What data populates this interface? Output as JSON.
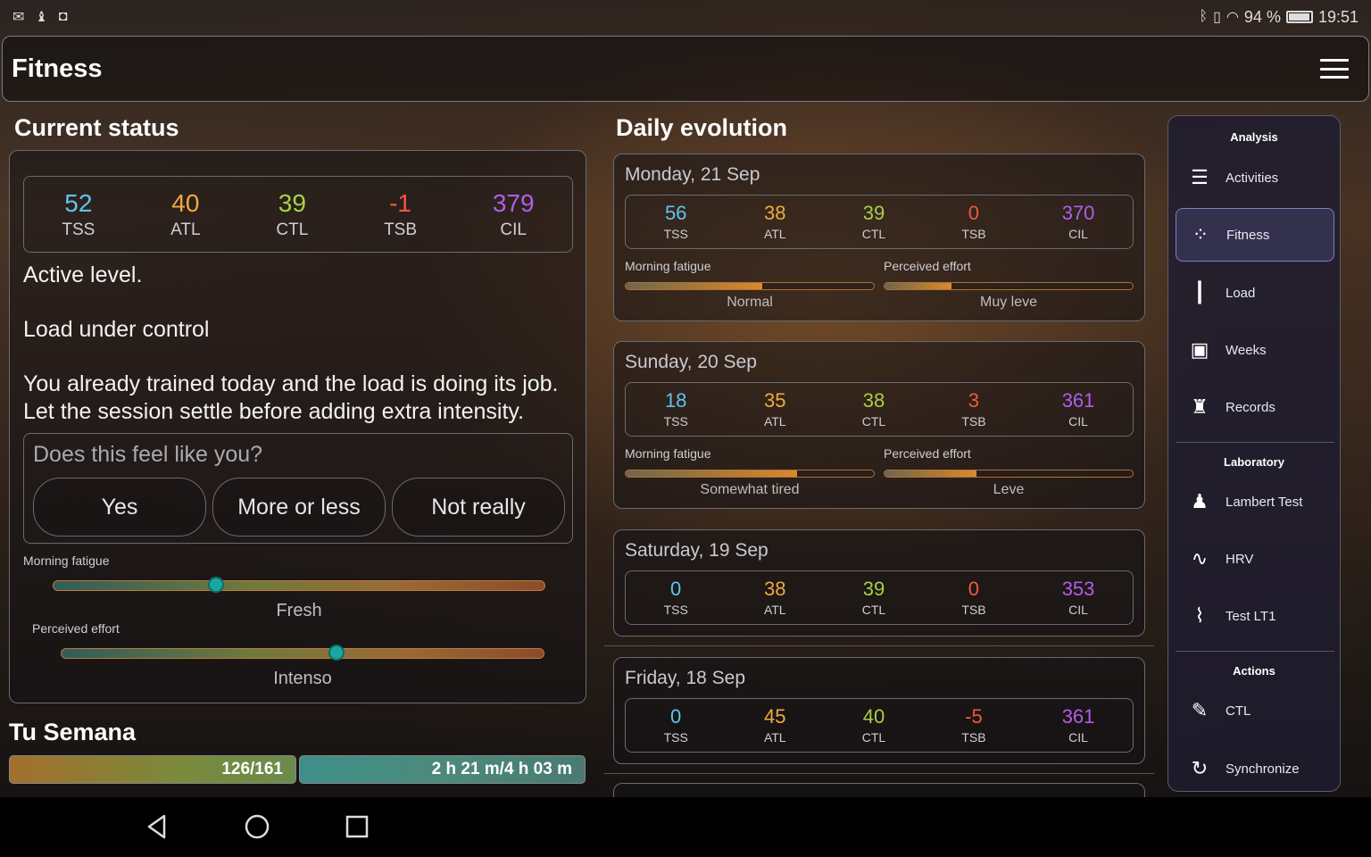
{
  "status_bar": {
    "time": "19:51",
    "battery": "94 %"
  },
  "app": {
    "title": "Fitness"
  },
  "current_status": {
    "title": "Current status",
    "metrics": [
      {
        "value": "52",
        "label": "TSS"
      },
      {
        "value": "40",
        "label": "ATL"
      },
      {
        "value": "39",
        "label": "CTL"
      },
      {
        "value": "-1",
        "label": "TSB"
      },
      {
        "value": "379",
        "label": "CIL"
      }
    ],
    "level": "Active level.",
    "load_status": "Load under control",
    "message_line1": "You already trained today and the load is doing its job.",
    "message_line2": "Let the session settle before adding extra intensity.",
    "question": "Does this feel like you?",
    "answers": [
      "Yes",
      "More or less",
      "Not really"
    ],
    "morning_fatigue_label": "Morning fatigue",
    "morning_fatigue_value": "Fresh",
    "morning_fatigue_level": 0.33,
    "perceived_effort_label": "Perceived effort",
    "perceived_effort_value": "Intenso",
    "perceived_effort_level": 0.57
  },
  "week": {
    "title": "Tu Semana",
    "load": "126/161",
    "time": "2 h 21 m/4 h 03 m"
  },
  "daily": {
    "title": "Daily evolution",
    "days": [
      {
        "date": "Monday, 21 Sep",
        "metrics": [
          "56",
          "38",
          "39",
          "0",
          "370"
        ],
        "fatigue_label": "Morning fatigue",
        "fatigue": "Normal",
        "fatigue_level": 0.55,
        "effort_label": "Perceived effort",
        "effort": "Muy leve",
        "effort_level": 0.27
      },
      {
        "date": "Sunday, 20 Sep",
        "metrics": [
          "18",
          "35",
          "38",
          "3",
          "361"
        ],
        "fatigue_label": "Morning fatigue",
        "fatigue": "Somewhat tired",
        "fatigue_level": 0.69,
        "effort_label": "Perceived effort",
        "effort": "Leve",
        "effort_level": 0.37
      },
      {
        "date": "Saturday, 19 Sep",
        "metrics": [
          "0",
          "38",
          "39",
          "0",
          "353"
        ]
      },
      {
        "date": "Friday, 18 Sep",
        "metrics": [
          "0",
          "45",
          "40",
          "-5",
          "361"
        ]
      }
    ],
    "labels": [
      "TSS",
      "ATL",
      "CTL",
      "TSB",
      "CIL"
    ]
  },
  "menu": {
    "sections": {
      "analysis": "Analysis",
      "laboratory": "Laboratory",
      "actions": "Actions"
    },
    "items": [
      {
        "label": "Activities",
        "icon": "list-icon"
      },
      {
        "label": "Fitness",
        "icon": "dots-grid-icon"
      },
      {
        "label": "Load",
        "icon": "bars-icon"
      },
      {
        "label": "Weeks",
        "icon": "chart-icon"
      },
      {
        "label": "Records",
        "icon": "trophy-icon"
      },
      {
        "label": "Lambert Test",
        "icon": "runner-icon"
      },
      {
        "label": "HRV",
        "icon": "heartbeat-icon"
      },
      {
        "label": "Test LT1",
        "icon": "stairs-icon"
      },
      {
        "label": "CTL",
        "icon": "wand-icon"
      },
      {
        "label": "Synchronize",
        "icon": "sync-icon"
      }
    ]
  },
  "colors": {
    "tss": "#5ec3f0",
    "atl": "#f0a940",
    "ctl": "#a7d046",
    "tsb": "#f0593f",
    "cil": "#b05ee8"
  }
}
